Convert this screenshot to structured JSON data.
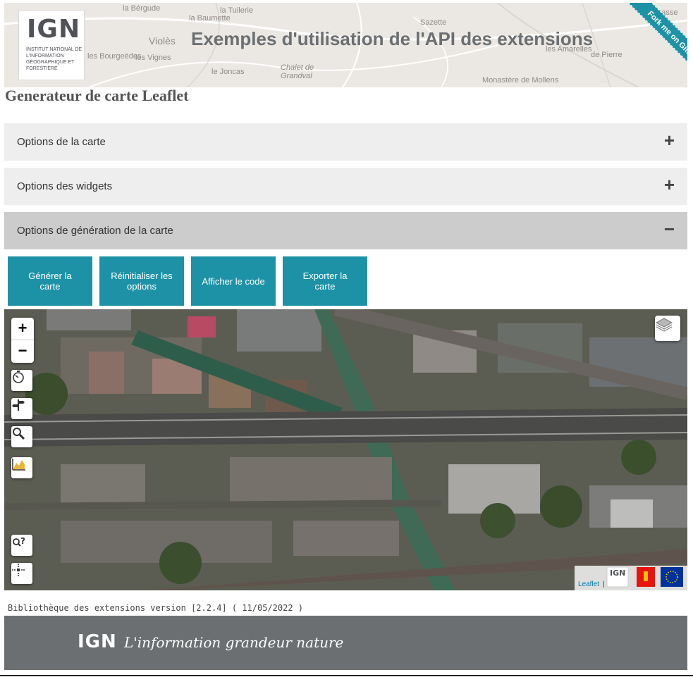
{
  "header": {
    "logo_text": "IGN",
    "logo_subtitle": "INSTITUT NATIONAL DE L'INFORMATION GÉOGRAPHIQUE ET FORESTIÈRE",
    "title": "Exemples d'utilisation de l'API des extensions",
    "ribbon": "Fork me on GitHub",
    "map_labels": [
      "la Bérgude",
      "la Baumette",
      "la Tuilerie",
      "Sazette",
      "Grasse",
      "Violès",
      "les Bourgeëdes",
      "les Vignes",
      "le Joncas",
      "Chalet de Grandval",
      "Monastère de Mollens",
      "les Amarelles",
      "de Pierre"
    ]
  },
  "page_title": "Generateur de carte Leaflet",
  "accordion": [
    {
      "label": "Options de la carte",
      "sign": "+"
    },
    {
      "label": "Options des widgets",
      "sign": "+"
    },
    {
      "label": "Options de génération de la carte",
      "sign": "−"
    }
  ],
  "buttons": [
    {
      "label": "Générer la carte"
    },
    {
      "label": "Réinitialiser les options"
    },
    {
      "label": "Afficher le code"
    },
    {
      "label": "Exporter la carte"
    }
  ],
  "map": {
    "zoom_in": "+",
    "zoom_out": "−",
    "attribution_link": "Leaflet",
    "attribution_sep": "|"
  },
  "version_text": "Bibliothèque des extensions version [2.2.4] ( 11/05/2022 )",
  "footer": {
    "logo_text": "IGN",
    "slogan": "L'information grandeur nature"
  },
  "colors": {
    "accent": "#1d92a6",
    "accordion_bg": "#eeeeee",
    "accordion_open_bg": "#cccccc",
    "footer_bg": "#6b6f72"
  },
  "icons": [
    "layers-icon",
    "timer-icon",
    "signpost-icon",
    "search-icon",
    "elevation-icon",
    "reverse-geocode-icon",
    "mouse-position-icon"
  ]
}
